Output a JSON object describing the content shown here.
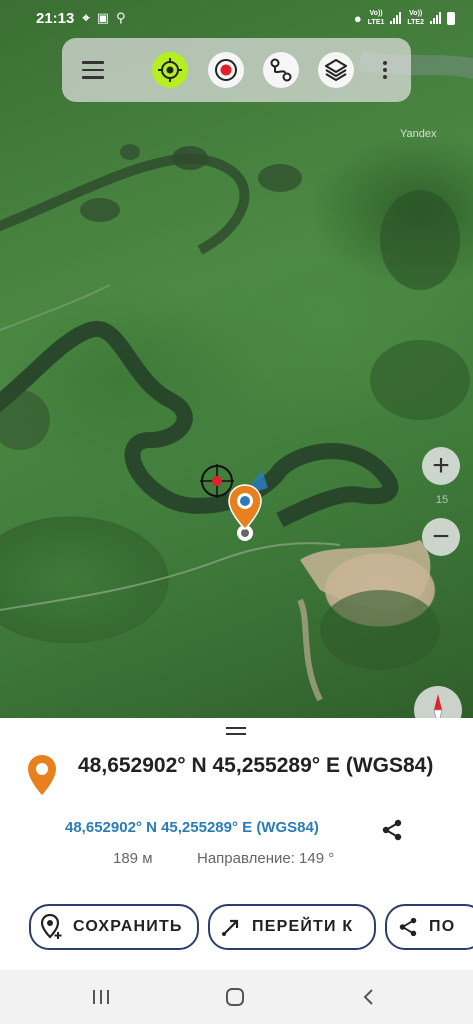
{
  "status_bar": {
    "time": "21:13",
    "sim1": "Vo))\nLTE1",
    "sim1_top": "Vo))",
    "sim1_bottom": "LTE1",
    "sim2_top": "Vo))",
    "sim2_bottom": "LTE2"
  },
  "toolbar": {
    "menu_icon": "hamburger-menu-icon",
    "buttons": [
      {
        "name": "locate",
        "icon": "crosshair-icon",
        "color": "#b6ef1f"
      },
      {
        "name": "record",
        "icon": "record-icon",
        "color": "#e0202a"
      },
      {
        "name": "route",
        "icon": "route-icon"
      },
      {
        "name": "layers",
        "icon": "layers-icon"
      }
    ],
    "more_icon": "more-vertical-icon"
  },
  "map": {
    "provider_label": "Yandex",
    "zoom_in_label": "+",
    "zoom_out_label": "−",
    "zoom_level": "15",
    "marker_color": "#e8801e"
  },
  "sheet": {
    "title": "48,652902° N 45,255289° E (WGS84)",
    "link": "48,652902° N 45,255289° E (WGS84)",
    "distance": "189 м",
    "direction": "Направление: 149 °",
    "buttons": {
      "save": "СОХРАНИТЬ",
      "goto": "ПЕРЕЙТИ К",
      "more": "ПО"
    }
  },
  "colors": {
    "accent_green": "#b6ef1f",
    "pin_orange": "#e8801e",
    "link_blue": "#2a7cb8",
    "button_border": "#2c3e6b"
  }
}
